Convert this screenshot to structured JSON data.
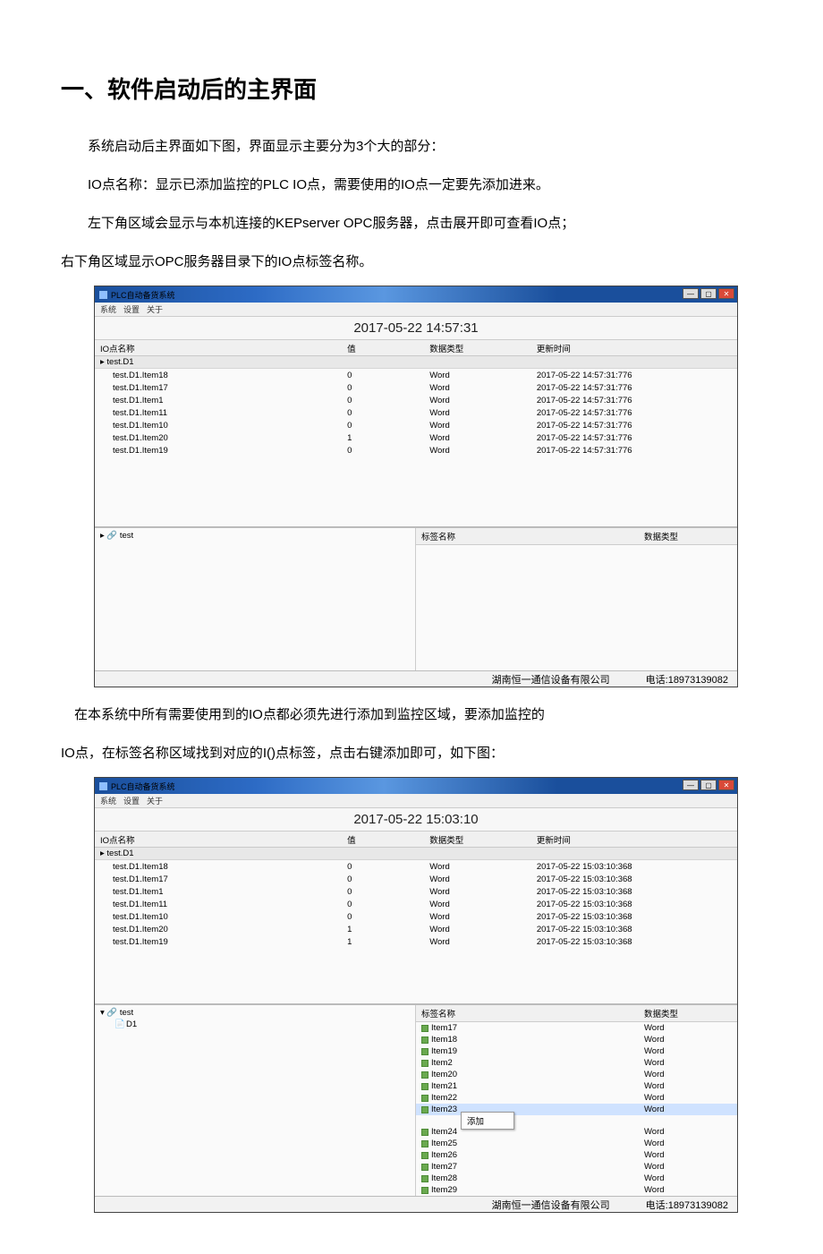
{
  "heading": "一、软件启动后的主界面",
  "para1": "系统启动后主界面如下图，界面显示主要分为3个大的部分：",
  "para2": "IO点名称：显示已添加监控的PLC IO点，需要使用的IO点一定要先添加进来。",
  "para3": "左下角区域会显示与本机连接的KEPserver OPC服务器，点击展开即可查看IO点；",
  "para4": "右下角区域显示OPC服务器目录下的IO点标签名称。",
  "para5": "在本系统中所有需要使用到的IO点都必须先进行添加到监控区域，要添加监控的",
  "para6": "IO点，在标签名称区域找到对应的I()点标签，点击右键添加即可，如下图：",
  "app": {
    "title": "PLC自动备货系统",
    "menu": [
      "系统",
      "设置",
      "关于"
    ],
    "footer_company": "湖南恒一通信设备有限公司",
    "footer_phone": "电话:18973139082"
  },
  "grid_headers": {
    "c1": "IO点名称",
    "c2": "值",
    "c3": "数据类型",
    "c4": "更新时间"
  },
  "tags_header": {
    "c1": "标签名称",
    "c2": "数据类型"
  },
  "shot1": {
    "datetime": "2017-05-22 14:57:31",
    "group": "▸ test.D1",
    "rows": [
      {
        "n": "test.D1.Item18",
        "v": "0",
        "t": "Word",
        "ts": "2017-05-22 14:57:31:776"
      },
      {
        "n": "test.D1.Item17",
        "v": "0",
        "t": "Word",
        "ts": "2017-05-22 14:57:31:776"
      },
      {
        "n": "test.D1.Item1",
        "v": "0",
        "t": "Word",
        "ts": "2017-05-22 14:57:31:776"
      },
      {
        "n": "test.D1.Item11",
        "v": "0",
        "t": "Word",
        "ts": "2017-05-22 14:57:31:776"
      },
      {
        "n": "test.D1.Item10",
        "v": "0",
        "t": "Word",
        "ts": "2017-05-22 14:57:31:776"
      },
      {
        "n": "test.D1.Item20",
        "v": "1",
        "t": "Word",
        "ts": "2017-05-22 14:57:31:776"
      },
      {
        "n": "test.D1.Item19",
        "v": "0",
        "t": "Word",
        "ts": "2017-05-22 14:57:31:776"
      }
    ],
    "tree_root": "▸ 🔗 test",
    "tags": []
  },
  "shot2": {
    "datetime": "2017-05-22 15:03:10",
    "group": "▸ test.D1",
    "rows": [
      {
        "n": "test.D1.Item18",
        "v": "0",
        "t": "Word",
        "ts": "2017-05-22 15:03:10:368"
      },
      {
        "n": "test.D1.Item17",
        "v": "0",
        "t": "Word",
        "ts": "2017-05-22 15:03:10:368"
      },
      {
        "n": "test.D1.Item1",
        "v": "0",
        "t": "Word",
        "ts": "2017-05-22 15:03:10:368"
      },
      {
        "n": "test.D1.Item11",
        "v": "0",
        "t": "Word",
        "ts": "2017-05-22 15:03:10:368"
      },
      {
        "n": "test.D1.Item10",
        "v": "0",
        "t": "Word",
        "ts": "2017-05-22 15:03:10:368"
      },
      {
        "n": "test.D1.Item20",
        "v": "1",
        "t": "Word",
        "ts": "2017-05-22 15:03:10:368"
      },
      {
        "n": "test.D1.Item19",
        "v": "1",
        "t": "Word",
        "ts": "2017-05-22 15:03:10:368"
      }
    ],
    "tree_root": "▾ 🔗 test",
    "tree_child_icon": "📄",
    "tree_child_label": "D1",
    "context_menu_label": "添加",
    "tags": [
      {
        "n": "Item17",
        "t": "Word"
      },
      {
        "n": "Item18",
        "t": "Word"
      },
      {
        "n": "Item19",
        "t": "Word"
      },
      {
        "n": "Item2",
        "t": "Word"
      },
      {
        "n": "Item20",
        "t": "Word"
      },
      {
        "n": "Item21",
        "t": "Word"
      },
      {
        "n": "Item22",
        "t": "Word"
      },
      {
        "n": "Item23",
        "t": "Word",
        "sel": true,
        "ctx": true
      },
      {
        "n": "Item24",
        "t": "Word"
      },
      {
        "n": "Item25",
        "t": "Word"
      },
      {
        "n": "Item26",
        "t": "Word"
      },
      {
        "n": "Item27",
        "t": "Word"
      },
      {
        "n": "Item28",
        "t": "Word"
      },
      {
        "n": "Item29",
        "t": "Word"
      }
    ]
  }
}
